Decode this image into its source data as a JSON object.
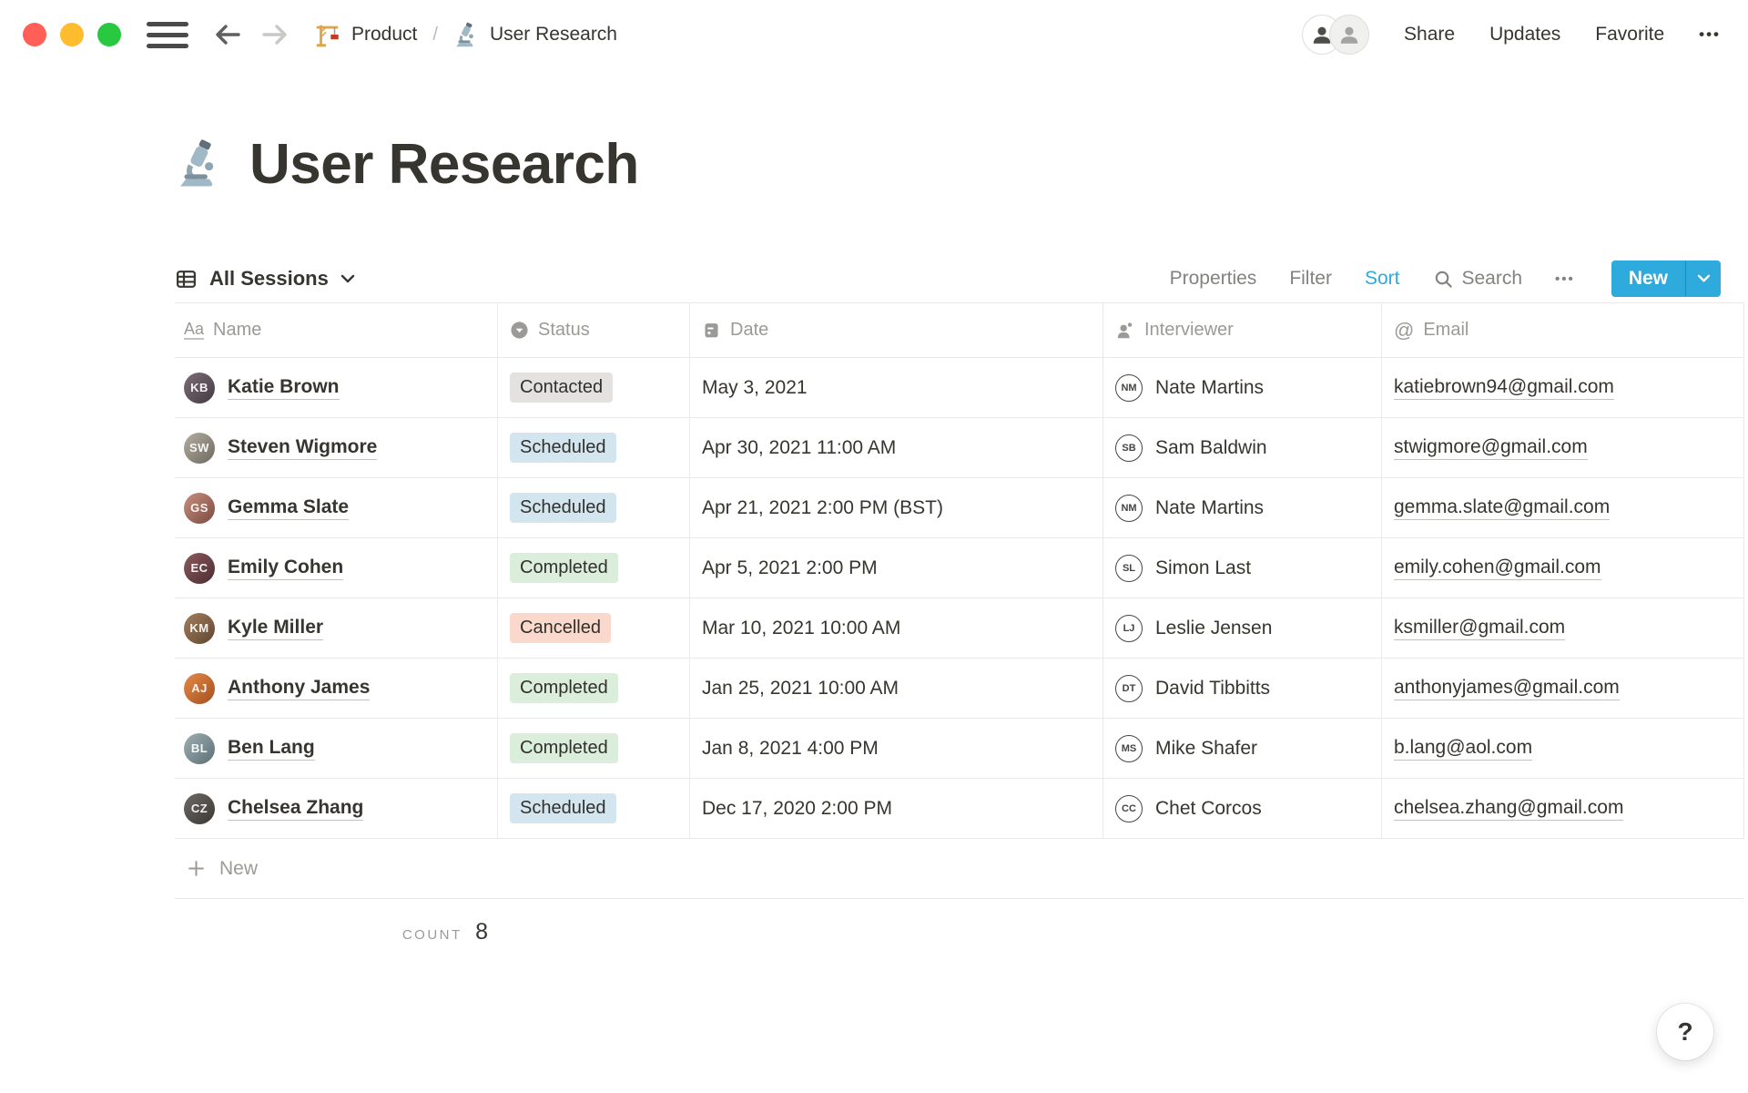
{
  "window": {
    "controls": [
      {
        "name": "close",
        "style": "background:#FF5F57"
      },
      {
        "name": "minimize",
        "style": "background:#FEBC2E"
      },
      {
        "name": "zoom",
        "style": "background:#28C840"
      }
    ]
  },
  "topbar": {
    "breadcrumb": {
      "parent": "Product",
      "separator": "/",
      "current": "User Research"
    },
    "share_label": "Share",
    "updates_label": "Updates",
    "favorite_label": "Favorite",
    "more_label": "•••"
  },
  "page": {
    "icon": "microscope",
    "title": "User Research"
  },
  "view_bar": {
    "view_name": "All Sessions",
    "properties_label": "Properties",
    "filter_label": "Filter",
    "sort_label": "Sort",
    "search_label": "Search",
    "more_label": "•••",
    "new_label": "New",
    "accent_color": "#2EAADC"
  },
  "table": {
    "columns": [
      {
        "label": "Name",
        "icon": "text-icon"
      },
      {
        "label": "Status",
        "icon": "select-icon"
      },
      {
        "label": "Date",
        "icon": "date-icon"
      },
      {
        "label": "Interviewer",
        "icon": "person-icon"
      },
      {
        "label": "Email",
        "icon": "at-icon"
      }
    ],
    "status_colors": {
      "Contacted": "#E3E2E0",
      "Scheduled": "#D3E5EF",
      "Completed": "#DBEDDB",
      "Cancelled": "#FAD9CC"
    },
    "rows": [
      {
        "name": "Katie Brown",
        "initials": "KB",
        "avatar_style": "background:linear-gradient(135deg,#7d6e78,#433a42)",
        "status": "Contacted",
        "status_style": "background:#E3E2E0",
        "date": "May 3, 2021",
        "interviewer": "Nate Martins",
        "interviewer_initials": "NM",
        "email": "katiebrown94@gmail.com"
      },
      {
        "name": "Steven Wigmore",
        "initials": "SW",
        "avatar_style": "background:linear-gradient(135deg,#b3aea2,#6e685e)",
        "status": "Scheduled",
        "status_style": "background:#D3E5EF",
        "date": "Apr 30, 2021 11:00 AM",
        "interviewer": "Sam Baldwin",
        "interviewer_initials": "SB",
        "email": "stwigmore@gmail.com"
      },
      {
        "name": "Gemma Slate",
        "initials": "GS",
        "avatar_style": "background:linear-gradient(135deg,#c98f7e,#7a4a41)",
        "status": "Scheduled",
        "status_style": "background:#D3E5EF",
        "date": "Apr 21, 2021 2:00 PM (BST)",
        "interviewer": "Nate Martins",
        "interviewer_initials": "NM",
        "email": "gemma.slate@gmail.com"
      },
      {
        "name": "Emily Cohen",
        "initials": "EC",
        "avatar_style": "background:linear-gradient(135deg,#8c5a5e,#4a2e33)",
        "status": "Completed",
        "status_style": "background:#DBEDDB",
        "date": "Apr 5, 2021 2:00 PM",
        "interviewer": "Simon Last",
        "interviewer_initials": "SL",
        "email": "emily.cohen@gmail.com"
      },
      {
        "name": "Kyle Miller",
        "initials": "KM",
        "avatar_style": "background:linear-gradient(135deg,#a57f5f,#5d4630)",
        "status": "Cancelled",
        "status_style": "background:#FAD9CC",
        "date": "Mar 10, 2021 10:00 AM",
        "interviewer": "Leslie Jensen",
        "interviewer_initials": "LJ",
        "email": "ksmiller@gmail.com"
      },
      {
        "name": "Anthony James",
        "initials": "AJ",
        "avatar_style": "background:linear-gradient(135deg,#e58a4a,#a34f1f)",
        "status": "Completed",
        "status_style": "background:#DBEDDB",
        "date": "Jan 25, 2021 10:00 AM",
        "interviewer": "David Tibbitts",
        "interviewer_initials": "DT",
        "email": "anthonyjames@gmail.com"
      },
      {
        "name": "Ben Lang",
        "initials": "BL",
        "avatar_style": "background:linear-gradient(135deg,#9fb0b5,#5d6e74)",
        "status": "Completed",
        "status_style": "background:#DBEDDB",
        "date": "Jan 8, 2021 4:00 PM",
        "interviewer": "Mike Shafer",
        "interviewer_initials": "MS",
        "email": "b.lang@aol.com"
      },
      {
        "name": "Chelsea Zhang",
        "initials": "CZ",
        "avatar_style": "background:linear-gradient(135deg,#6f6a66,#3a3734)",
        "status": "Scheduled",
        "status_style": "background:#D3E5EF",
        "date": "Dec 17, 2020 2:00 PM",
        "interviewer": "Chet Corcos",
        "interviewer_initials": "CC",
        "email": "chelsea.zhang@gmail.com"
      }
    ],
    "new_row_label": "New",
    "count_label": "COUNT",
    "count_value": "8"
  },
  "help_label": "?"
}
